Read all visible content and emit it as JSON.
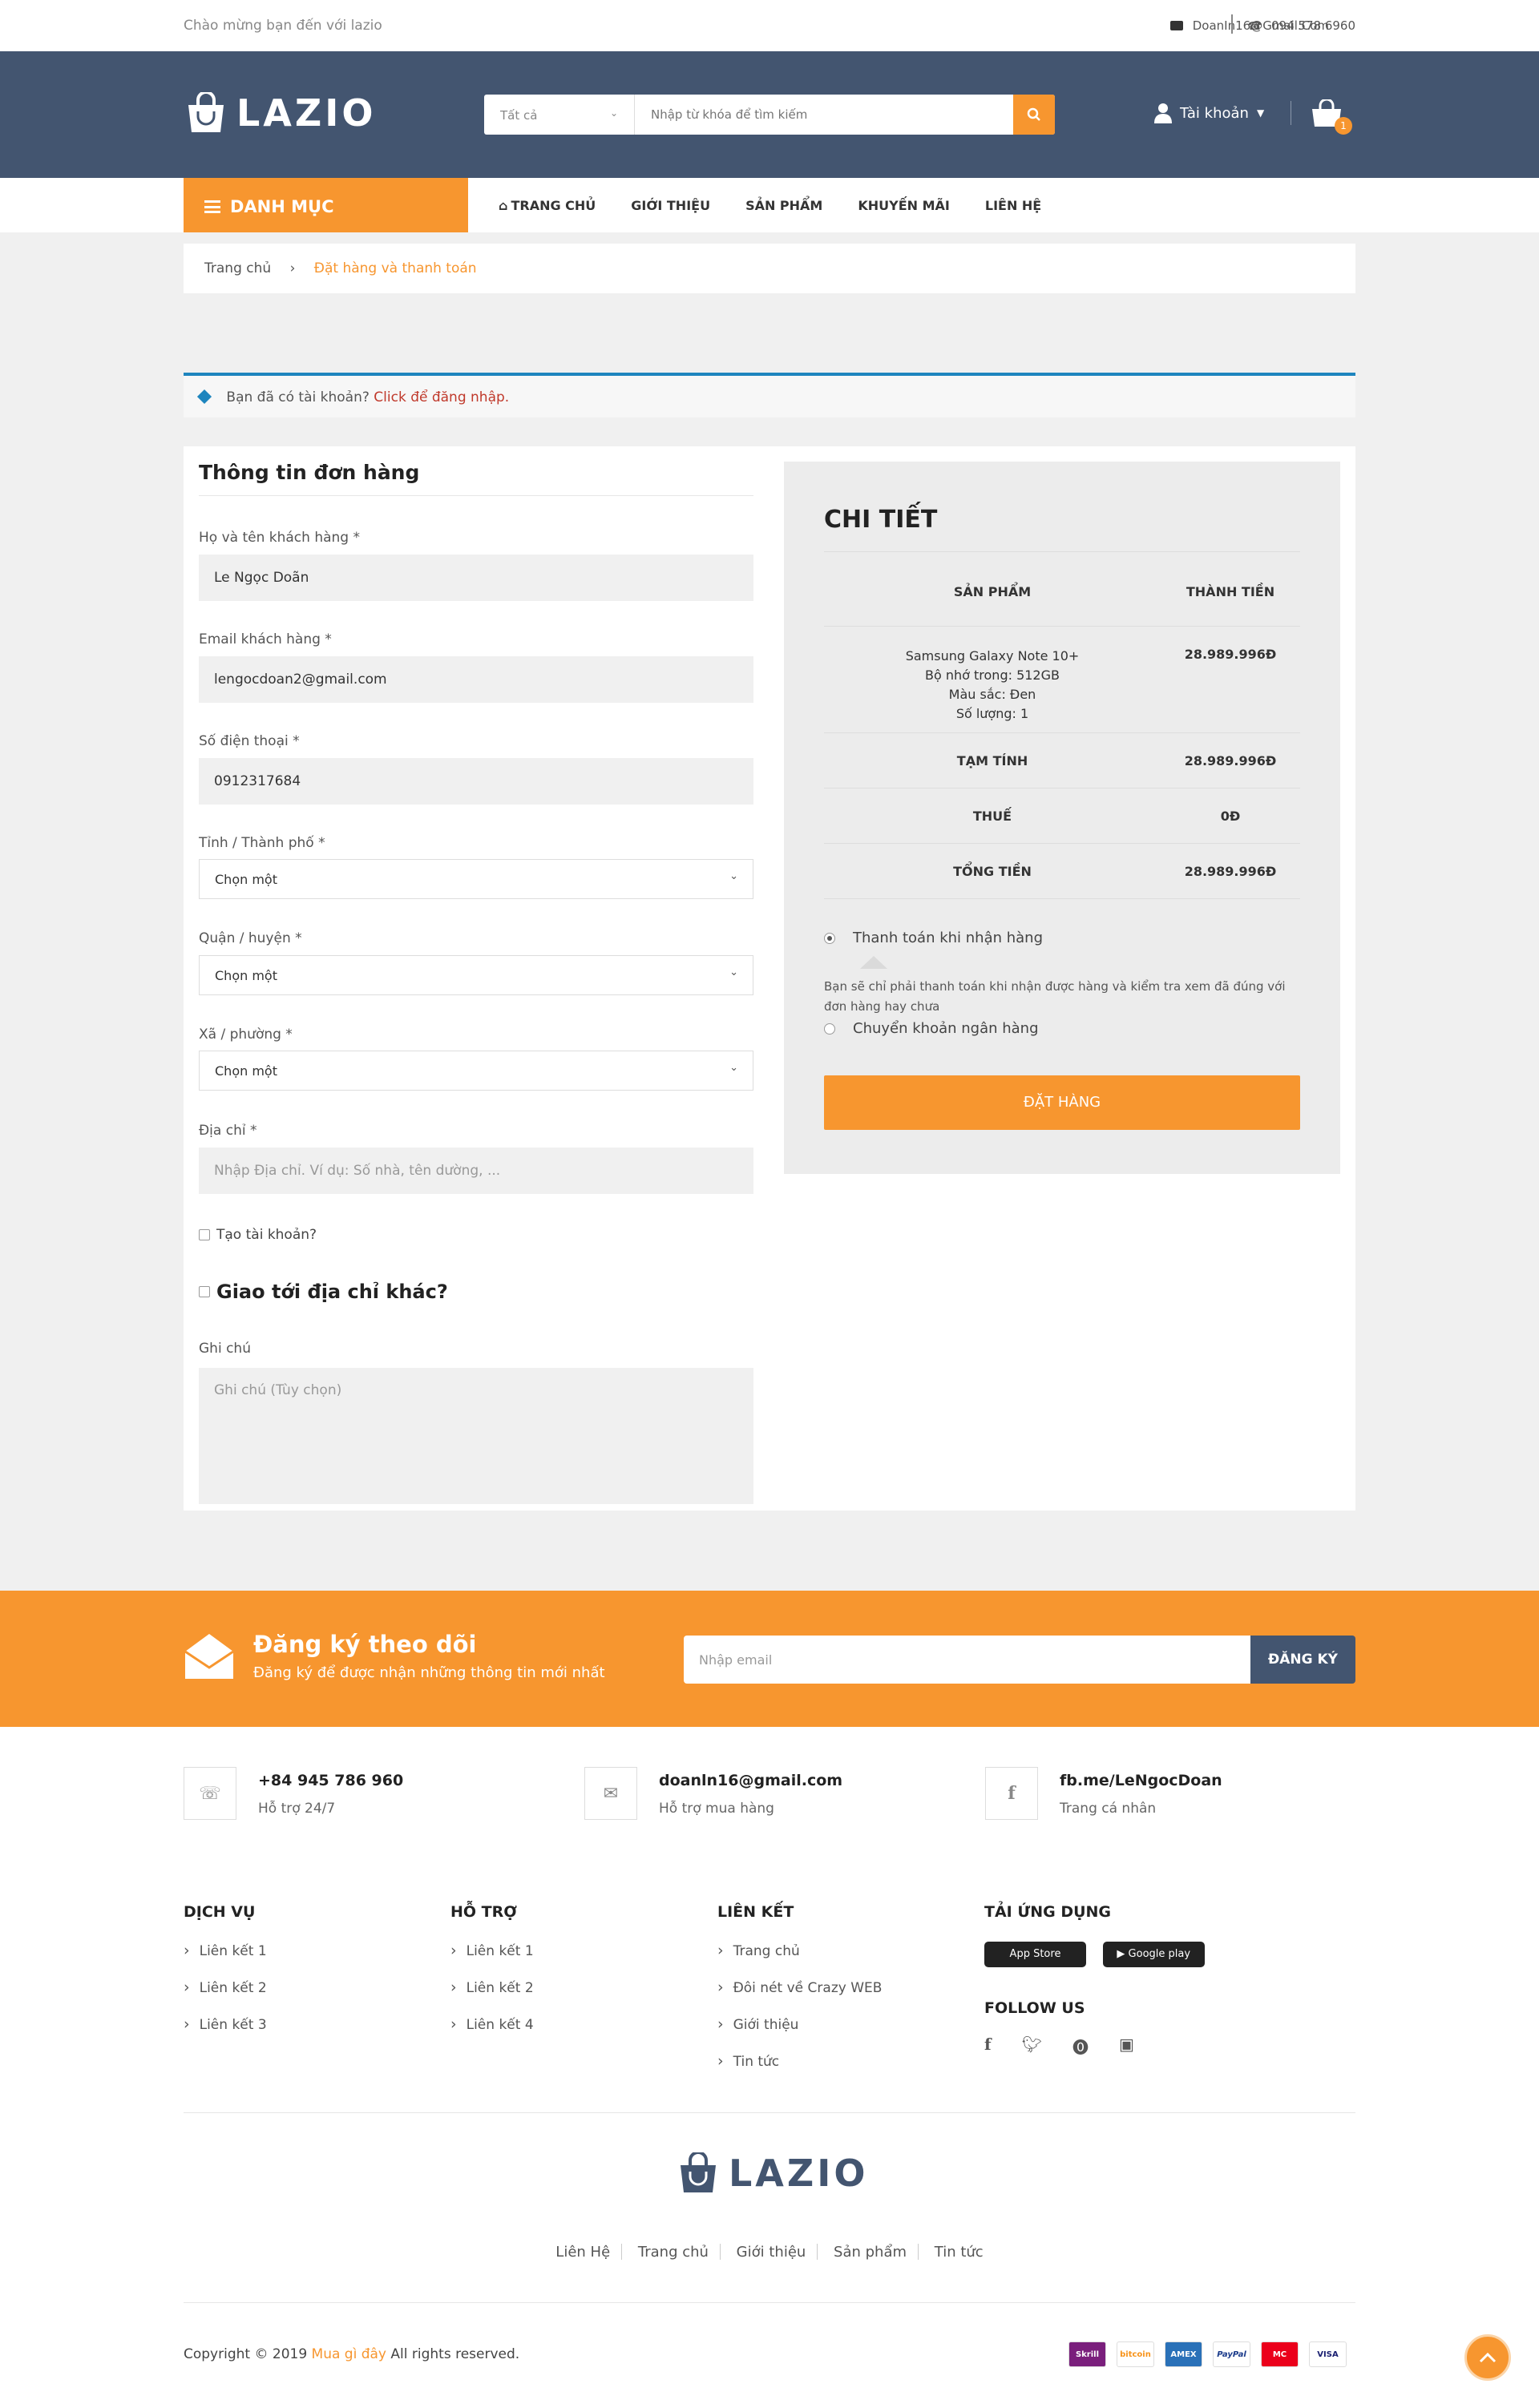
{
  "topbar": {
    "welcome": "Chào mừng bạn đến với lazio",
    "email": "DoanIn16@Gmail.Com",
    "phone": "094 578 6960"
  },
  "header": {
    "logo": "LAZIO",
    "search_category": "Tất cả",
    "search_placeholder": "Nhập từ khóa để tìm kiếm",
    "account_label": "Tài khoản",
    "cart_count": "1"
  },
  "nav": {
    "menu_label": "DANH MỤC",
    "items": [
      "TRANG CHỦ",
      "GIỚI THIỆU",
      "SẢN PHẨM",
      "KHUYẾN MÃI",
      "LIÊN HỆ"
    ]
  },
  "breadcrumb": {
    "home": "Trang chủ",
    "current": "Đặt hàng và thanh toán"
  },
  "notice": {
    "text": "Bạn đã có tài khoản?",
    "link": "Click để đăng nhập."
  },
  "form": {
    "title": "Thông tin đơn hàng",
    "name_label": "Họ và tên khách hàng *",
    "name_value": "Le Ngọc Doãn",
    "email_label": "Email khách hàng *",
    "email_value": "lengocdoan2@gmail.com",
    "phone_label": "Số điện thoại *",
    "phone_value": "0912317684",
    "city_label": "Tỉnh / Thành phố *",
    "city_value": "Chọn một",
    "district_label": "Quận / huyện *",
    "district_value": "Chọn một",
    "ward_label": "Xã / phường *",
    "ward_value": "Chọn một",
    "address_label": "Địa chỉ *",
    "address_placeholder": "Nhập Địa chỉ. Ví dụ: Số nhà, tên dường, ...",
    "create_account": "Tạo tài khoản?",
    "ship_other": "Giao tới địa chỉ khác?",
    "note_label": "Ghi chú",
    "note_placeholder": "Ghi chú (Tùy chọn)"
  },
  "details": {
    "title": "CHI TIẾT",
    "col_product": "SẢN PHẨM",
    "col_total": "THÀNH TIỀN",
    "product_lines": [
      "Samsung Galaxy Note 10+",
      "Bộ nhớ trong: 512GB",
      "Màu sắc: Đen",
      "Số lượng: 1"
    ],
    "product_price": "28.989.996Đ",
    "subtotal_label": "TẠM TÍNH",
    "subtotal_value": "28.989.996Đ",
    "tax_label": "THUẾ",
    "tax_value": "0Đ",
    "total_label": "TỔNG TIỀN",
    "total_value": "28.989.996Đ",
    "pay_cod": "Thanh toán khi nhận hàng",
    "pay_cod_desc": "Bạn sẽ chỉ phải thanh toán khi nhận được hàng và kiểm tra xem đã đúng với đơn hàng hay chưa",
    "pay_bank": "Chuyển khoản ngân hàng",
    "order_button": "ĐẶT HÀNG"
  },
  "newsletter": {
    "title": "Đăng ký theo dõi",
    "subtitle": "Đăng ký để được nhận những thông tin mới nhất",
    "placeholder": "Nhập email",
    "button": "ĐĂNG KÝ"
  },
  "footer": {
    "contact_phone": "+84 945 786 960",
    "contact_phone_sub": "Hỗ trợ 24/7",
    "contact_email": "doanln16@gmail.com",
    "contact_email_sub": "Hỗ trợ mua hàng",
    "contact_fb": "fb.me/LeNgocDoan",
    "contact_fb_sub": "Trang cá nhân",
    "col1_title": "DỊCH VỤ",
    "col1_items": [
      "Liên kết 1",
      "Liên kết 2",
      "Liên kết 3"
    ],
    "col2_title": "HỖ TRỢ",
    "col2_items": [
      "Liên kết 1",
      "Liên kết 2",
      "Liên kết 4"
    ],
    "col3_title": "LIÊN KẾT",
    "col3_items": [
      "Trang chủ",
      "Đôi nét về Crazy WEB",
      "Giới thiệu",
      "Tin tức"
    ],
    "col4_title": "TẢI ỨNG DỤNG",
    "app_store": "App Store",
    "google_play": "Google play",
    "follow_title": "FOLLOW US",
    "logo": "LAZIO",
    "bottom_links": [
      "Liên Hệ",
      "Trang chủ",
      "Giới thiệu",
      "Sản phẩm",
      "Tin tức"
    ],
    "copyright_pre": "Copyright © 2019",
    "copyright_brand": "Mua gì đây",
    "copyright_post": "All rights reserved.",
    "payments": [
      "Skrill",
      "bitcoin",
      "AMEX",
      "PayPal",
      "MC",
      "VISA"
    ]
  },
  "colors": {
    "accent": "#f7962f",
    "header_bg": "#435570",
    "link_blue": "#1e85be"
  }
}
